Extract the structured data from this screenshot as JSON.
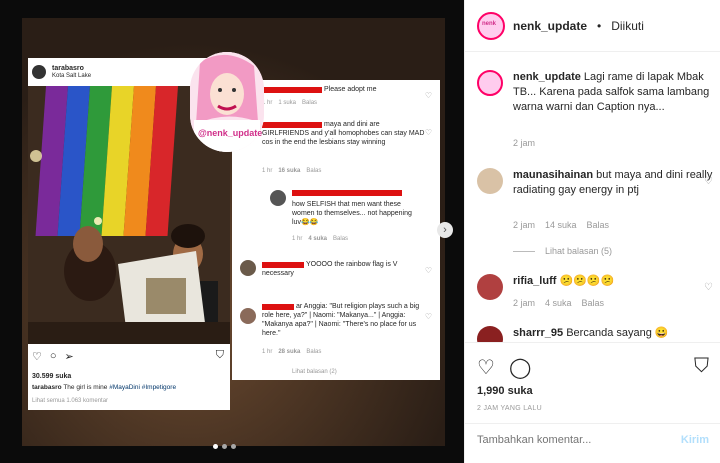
{
  "post_card": {
    "username": "tarabasro",
    "location": "Kota Salt Lake",
    "likes": "30.599 suka",
    "caption_user": "tarabasro",
    "caption_text": "The girl is mine",
    "caption_tags": "#MayaDini #Impetigore",
    "view_all": "Lihat semua 1.063 komentar"
  },
  "overlay_badge": "@nenk_update",
  "embedded_comments": [
    {
      "text": "Please adopt me",
      "time": "1 hr",
      "likes": "1 suka",
      "reply": "Balas"
    },
    {
      "text": "maya and dini are GIRLFRIENDS and y'all homophobes can stay MAD cos in the end the lesbians stay winning",
      "time": "1 hr",
      "likes": "16 suka",
      "reply": "Balas"
    },
    {
      "text": "how SELFISH that men want these women to themselves... not happening luv😂😂",
      "time": "1 hr",
      "likes": "4 suka",
      "reply": "Balas"
    },
    {
      "text": "YOOOO the rainbow flag is V necessary",
      "time": "",
      "likes": "",
      "reply": ""
    },
    {
      "text": "ar Anggia: \"But religion plays such a big role here, ya?\" | Naomi: \"Makanya...\" | Anggia: \"Makanya apa?\" | Naomi: \"There's no place for us here.\"",
      "time": "1 hr",
      "likes": "28 suka",
      "reply": "Balas"
    },
    {
      "text": "Lihat balasan (2)"
    }
  ],
  "header": {
    "username": "nenk_update",
    "separator": "•",
    "follow_status": "Diikuti"
  },
  "comments": [
    {
      "user": "nenk_update",
      "text": "Lagi rame di lapak Mbak TB... Karena pada salfok sama lambang warna warni dan Caption nya...",
      "time": "2 jam",
      "likes": "",
      "reply": ""
    },
    {
      "user": "maunasihainan",
      "text": "but maya and dini really radiating gay energy in ptj",
      "time": "2 jam",
      "likes": "14 suka",
      "reply": "Balas"
    },
    {
      "user": "rifia_luff",
      "text": "😕😕😕😕",
      "time": "2 jam",
      "likes": "4 suka",
      "reply": "Balas"
    },
    {
      "user": "sharrr_95",
      "text": "Bercanda sayang 😀",
      "time": "",
      "likes": "",
      "reply": ""
    }
  ],
  "view_replies": "Lihat balasan (5)",
  "likes_total": "1,990 suka",
  "post_time": "2 JAM YANG LALU",
  "add_comment": {
    "placeholder": "Tambahkan komentar...",
    "submit": "Kirim"
  }
}
